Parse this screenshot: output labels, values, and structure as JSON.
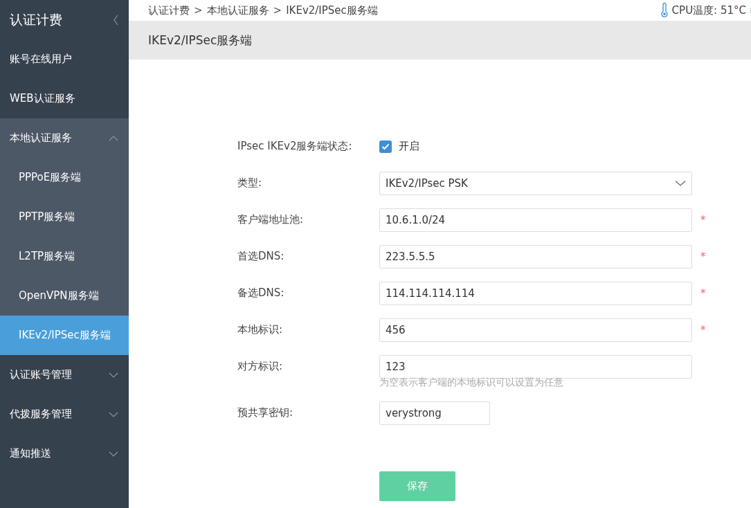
{
  "sidebar": {
    "title": "认证计费",
    "items": [
      {
        "kind": "link",
        "label": "账号在线用户"
      },
      {
        "kind": "link",
        "label": "WEB认证服务"
      },
      {
        "kind": "group",
        "label": "本地认证服务",
        "expanded": true,
        "children": [
          {
            "label": "PPPoE服务端",
            "selected": false
          },
          {
            "label": "PPTP服务端",
            "selected": false
          },
          {
            "label": "L2TP服务端",
            "selected": false
          },
          {
            "label": "OpenVPN服务端",
            "selected": false
          },
          {
            "label": "IKEv2/IPSec服务端",
            "selected": true
          }
        ]
      },
      {
        "kind": "group",
        "label": "认证账号管理",
        "expanded": false
      },
      {
        "kind": "group",
        "label": "代拨服务管理",
        "expanded": false
      },
      {
        "kind": "group",
        "label": "通知推送",
        "expanded": false
      }
    ]
  },
  "breadcrumb": [
    {
      "kind": "link",
      "text": "认证计费"
    },
    {
      "kind": "separator",
      "text": ">"
    },
    {
      "kind": "link",
      "text": "本地认证服务"
    },
    {
      "kind": "separator",
      "text": ">"
    },
    {
      "kind": "link",
      "text": "IKEv2/IPSec服务端"
    }
  ],
  "cpu_temperature": "CPU温度: 51°C",
  "page_title": "IKEv2/IPSec服务端",
  "form": {
    "rows": [
      {
        "kind": "checkbox",
        "label": "IPsec IKEv2服务端状态:",
        "checked": true,
        "option": "开启"
      },
      {
        "kind": "select",
        "label": "类型:",
        "value": "IKEv2/IPsec PSK"
      },
      {
        "kind": "input",
        "label": "客户端地址池:",
        "value": "10.6.1.0/24",
        "required_mark": "*"
      },
      {
        "kind": "input",
        "label": "首选DNS:",
        "value": "223.5.5.5",
        "required_mark": "*"
      },
      {
        "kind": "input",
        "label": "备选DNS:",
        "value": "114.114.114.114",
        "required_mark": "*"
      },
      {
        "kind": "input",
        "label": "本地标识:",
        "value": "456",
        "required_mark": "*"
      },
      {
        "kind": "input",
        "label": "对方标识:",
        "value": "123",
        "hint": "为空表示客户端的本地标识可以设置为任意"
      },
      {
        "kind": "key-input",
        "label": "预共享密钥:",
        "value": "verystrong"
      }
    ],
    "save_button": "保存"
  }
}
